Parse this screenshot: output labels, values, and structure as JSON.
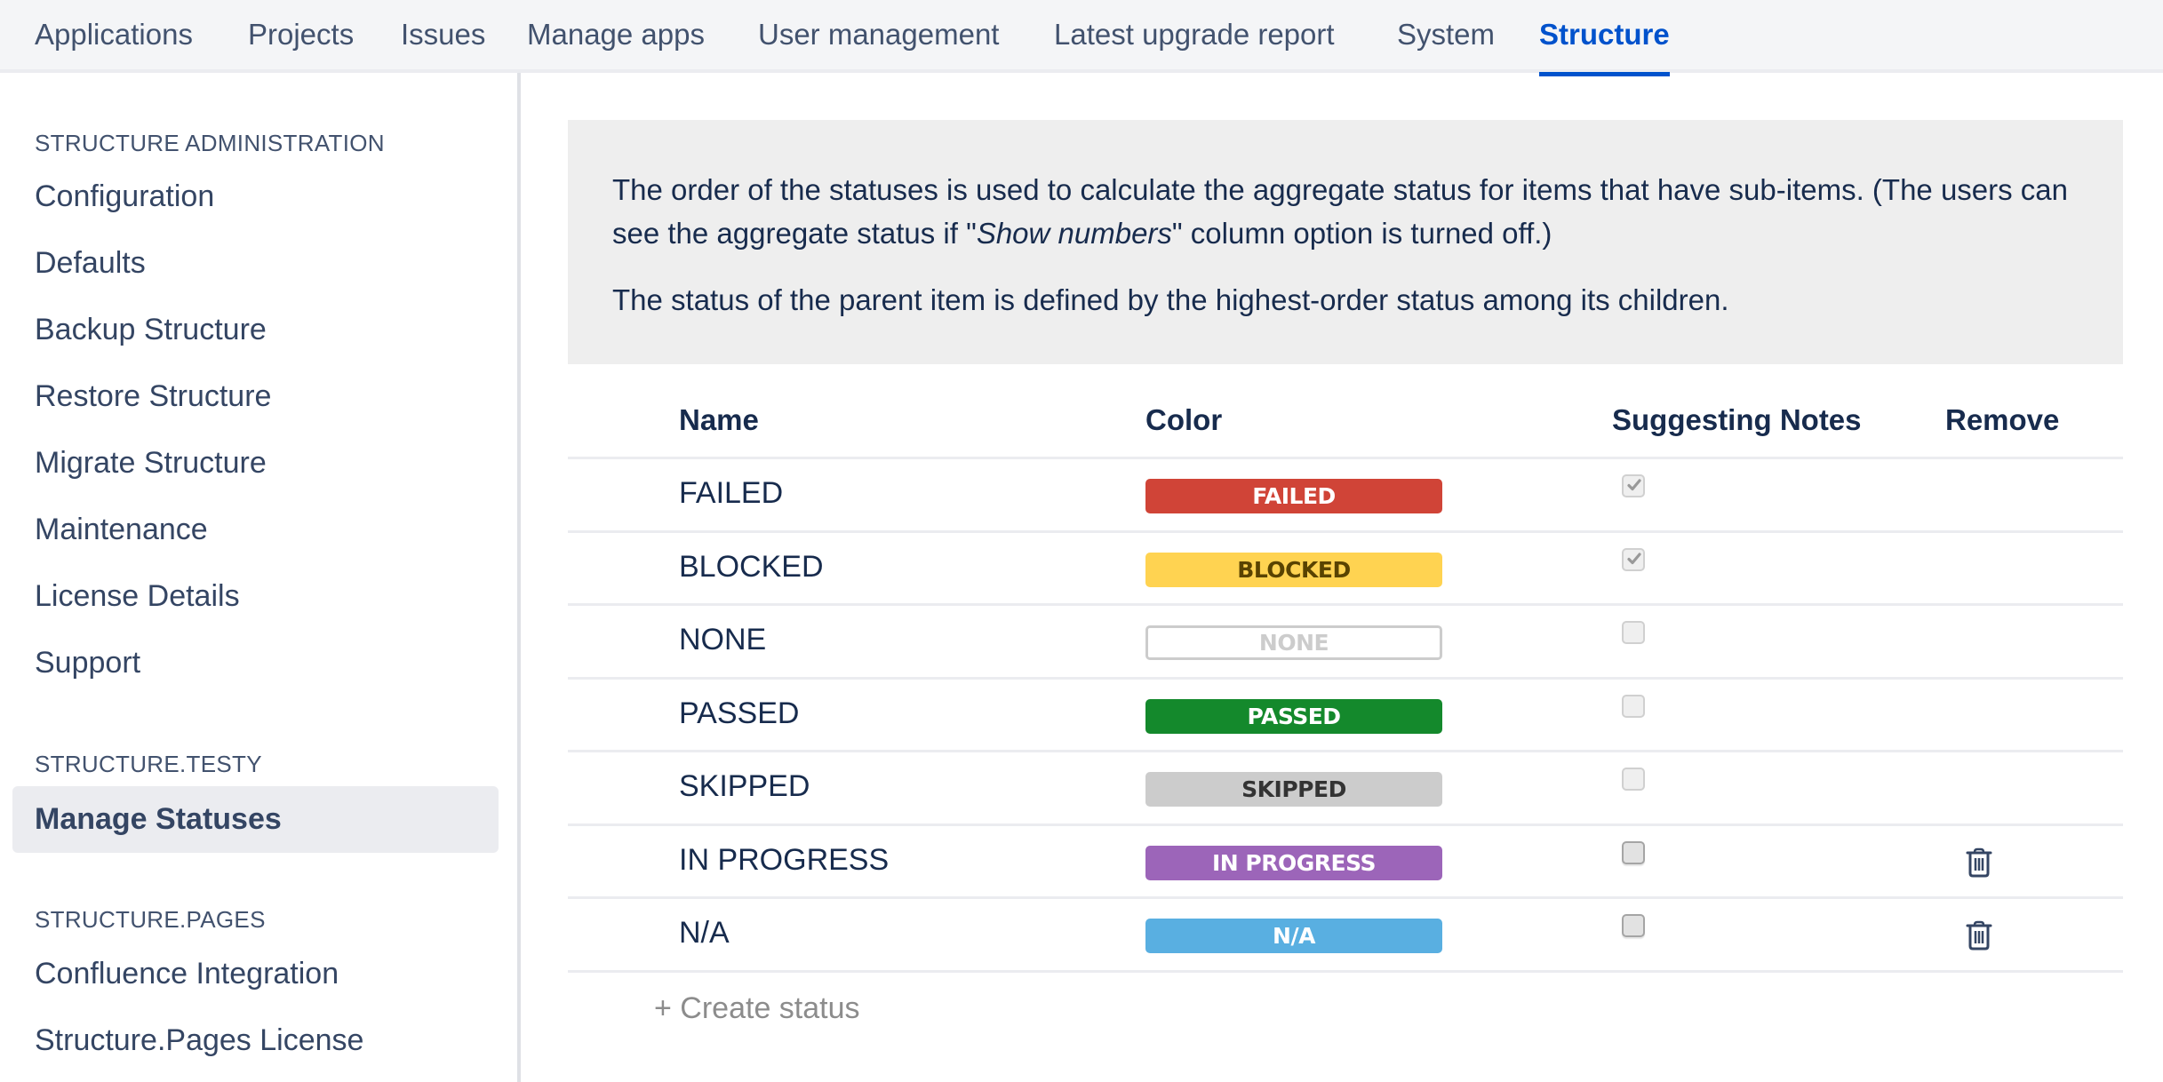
{
  "topnav": {
    "tabs": [
      {
        "label": "Applications",
        "active": false
      },
      {
        "label": "Projects",
        "active": false
      },
      {
        "label": "Issues",
        "active": false
      },
      {
        "label": "Manage apps",
        "active": false
      },
      {
        "label": "User management",
        "active": false
      },
      {
        "label": "Latest upgrade report",
        "active": false
      },
      {
        "label": "System",
        "active": false
      },
      {
        "label": "Structure",
        "active": true
      }
    ],
    "accent_color": "#0052cc"
  },
  "sidebar": {
    "sections": [
      {
        "heading": "STRUCTURE ADMINISTRATION",
        "items": [
          "Configuration",
          "Defaults",
          "Backup Structure",
          "Restore Structure",
          "Migrate Structure",
          "Maintenance",
          "License Details",
          "Support"
        ]
      },
      {
        "heading": "STRUCTURE.TESTY",
        "items": [
          "Manage Statuses"
        ],
        "active_item": "Manage Statuses"
      },
      {
        "heading": "STRUCTURE.PAGES",
        "items": [
          "Confluence Integration",
          "Structure.Pages License"
        ]
      }
    ]
  },
  "info": {
    "p1_before": "The order of the statuses is used to calculate the aggregate status for items that have sub-items. (The users can see the aggregate status if \"",
    "p1_em": "Show numbers",
    "p1_after": "\" column option is turned off.)",
    "p2": "The status of the parent item is defined by the highest-order status among its children."
  },
  "table": {
    "headers": {
      "name": "Name",
      "color": "Color",
      "notes": "Suggesting Notes",
      "remove": "Remove"
    },
    "rows": [
      {
        "name": "FAILED",
        "badge": "FAILED",
        "bg": "#d04437",
        "fg": "#ffffff",
        "outline": false,
        "notes_checked": true,
        "notes_enabled": false,
        "removable": false
      },
      {
        "name": "BLOCKED",
        "badge": "BLOCKED",
        "bg": "#ffd351",
        "fg": "#594300",
        "outline": false,
        "notes_checked": true,
        "notes_enabled": false,
        "removable": false
      },
      {
        "name": "NONE",
        "badge": "NONE",
        "bg": "#ffffff",
        "fg": "#cccccc",
        "outline": true,
        "notes_checked": false,
        "notes_enabled": false,
        "removable": false
      },
      {
        "name": "PASSED",
        "badge": "PASSED",
        "bg": "#14892c",
        "fg": "#ffffff",
        "outline": false,
        "notes_checked": false,
        "notes_enabled": false,
        "removable": false
      },
      {
        "name": "SKIPPED",
        "badge": "SKIPPED",
        "bg": "#cccccc",
        "fg": "#333333",
        "outline": false,
        "notes_checked": false,
        "notes_enabled": false,
        "removable": false
      },
      {
        "name": "IN PROGRESS",
        "badge": "IN PROGRESS",
        "bg": "#9c65b9",
        "fg": "#ffffff",
        "outline": false,
        "notes_checked": false,
        "notes_enabled": true,
        "removable": true
      },
      {
        "name": "N/A",
        "badge": "N/A",
        "bg": "#59afe1",
        "fg": "#ffffff",
        "outline": false,
        "notes_checked": false,
        "notes_enabled": true,
        "removable": true
      }
    ],
    "create_label": "+ Create status"
  }
}
